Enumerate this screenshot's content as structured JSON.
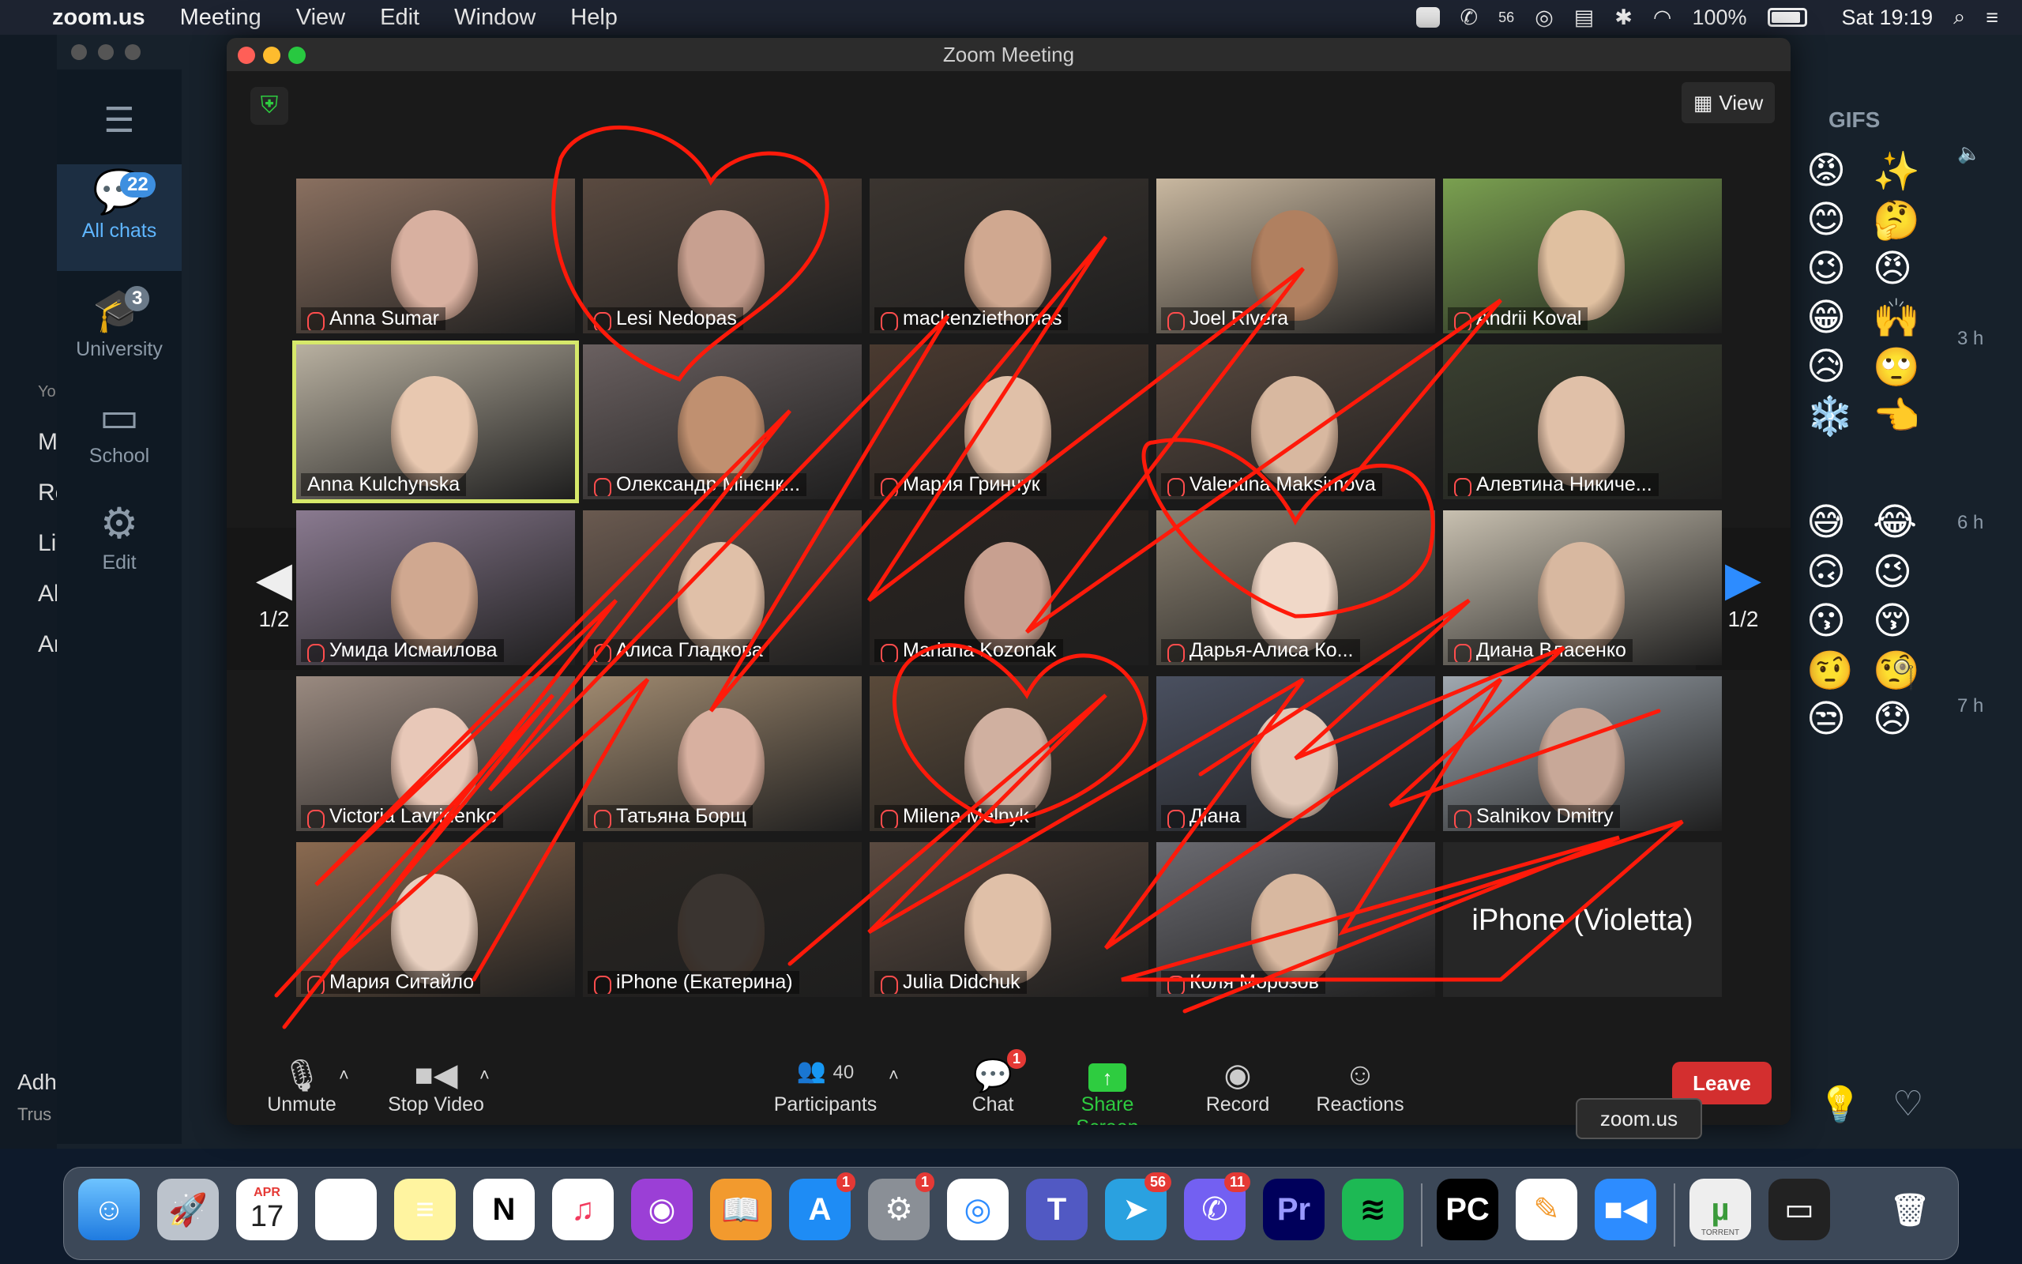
{
  "menubar": {
    "app_name": "zoom.us",
    "menus": [
      "Meeting",
      "View",
      "Edit",
      "Window",
      "Help"
    ],
    "battery": "100%",
    "clock": "Sat 19:19",
    "badge_56": "56"
  },
  "telegram": {
    "folders": [
      {
        "label": "All chats",
        "badge": "22",
        "icon": "chat-bubbles-icon"
      },
      {
        "label": "University",
        "badge": "3",
        "icon": "graduation-cap-icon"
      },
      {
        "label": "School",
        "badge": "",
        "icon": "folder-icon"
      },
      {
        "label": "Edit",
        "badge": "",
        "icon": "sliders-icon"
      }
    ],
    "left_fragments": [
      "Yo",
      "M",
      "Re",
      "Li",
      "Al",
      "Ar"
    ],
    "bottom_fragments": [
      "Adh",
      "Trus"
    ],
    "gifs_tab": "GIFS",
    "times": [
      "3 h",
      "6 h",
      "7 h"
    ],
    "emojis": [
      "😡",
      "✨",
      "😊",
      "🤔",
      "😉",
      "😠",
      "😁",
      "🙌",
      "😥",
      "🙄",
      "❄️",
      "👈",
      "😅",
      "😂",
      "🙃",
      "😉",
      "😗",
      "😚",
      "🤨",
      "🧐",
      "😒",
      "😞"
    ]
  },
  "zoom": {
    "title": "Zoom Meeting",
    "view_label": "View",
    "page_indicator_left": "1/2",
    "page_indicator_right": "1/2",
    "participants": [
      {
        "name": "Anna Sumar",
        "muted": true
      },
      {
        "name": "Lesi Nedopas",
        "muted": true
      },
      {
        "name": "mackenziethomas",
        "muted": true
      },
      {
        "name": "Joel Rivera",
        "muted": true
      },
      {
        "name": "Andrii Koval",
        "muted": true
      },
      {
        "name": "Anna Kulchynska",
        "muted": false,
        "active": true
      },
      {
        "name": "Олександр Мінєнк...",
        "muted": true
      },
      {
        "name": "Мария Гринчук",
        "muted": true
      },
      {
        "name": "Valentina Maksimova",
        "muted": true
      },
      {
        "name": "Алевтина Никиче...",
        "muted": true
      },
      {
        "name": "Умида Исмаилова",
        "muted": true
      },
      {
        "name": "Алиса Гладкова",
        "muted": true
      },
      {
        "name": "Mariana Kozonak",
        "muted": true
      },
      {
        "name": "Дарья-Алиса Ко...",
        "muted": true
      },
      {
        "name": "Диана Власенко",
        "muted": true
      },
      {
        "name": "Victoria Lavrinenko",
        "muted": true
      },
      {
        "name": "Татьяна Борщ",
        "muted": true
      },
      {
        "name": "Milena Melnyk",
        "muted": true
      },
      {
        "name": "Діана",
        "muted": true
      },
      {
        "name": "Salnikov Dmitry",
        "muted": true
      },
      {
        "name": "Мария Ситайло",
        "muted": true
      },
      {
        "name": "iPhone (Екатерина)",
        "muted": true
      },
      {
        "name": "Julia Didchuk",
        "muted": true
      },
      {
        "name": "Коля Морозов",
        "muted": true
      },
      {
        "name": "iPhone (Violetta)",
        "muted": true,
        "video_off": true
      }
    ],
    "toolbar": {
      "unmute": "Unmute",
      "stop_video": "Stop Video",
      "participants": "Participants",
      "participants_count": "40",
      "chat": "Chat",
      "chat_badge": "1",
      "share_screen": "Share Screen",
      "record": "Record",
      "reactions": "Reactions",
      "leave": "Leave"
    },
    "tooltip": "zoom.us"
  },
  "dock": {
    "calendar_month": "APR",
    "calendar_day": "17",
    "badges": {
      "appstore": "1",
      "settings": "1",
      "telegram": "56",
      "viber": "11"
    },
    "torrent_label": "TORRENT"
  },
  "colors": {
    "annotation": "#ff1a0a",
    "share_green": "#2ecc40",
    "leave_red": "#d32f2f",
    "active_outline": "#d6e86a"
  }
}
